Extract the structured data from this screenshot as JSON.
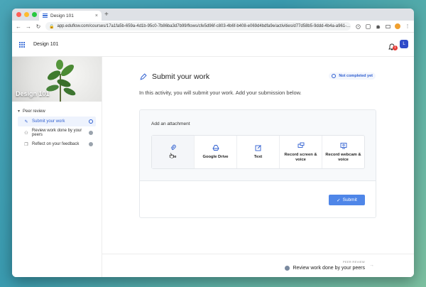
{
  "browser": {
    "tab_title": "Design 101",
    "tab_close": "×",
    "new_tab": "+",
    "url": "app.eduflow.com/courses/17a1fa5b-659a-4d1b-95c0-7b86ba3d7b99/flows/cfe5d96f-c803-4b6f-b408-e069d4bdfa9e/activities/d77d58b5-9ddd-4b4a-a961-...",
    "back": "←",
    "forward": "→",
    "reload": "↻",
    "lock": "🔒",
    "star": "☆",
    "menu": "⋮"
  },
  "header": {
    "course_title": "Design 101",
    "notification_count": "1",
    "user_initial": "L"
  },
  "sidebar": {
    "hero_title": "Design 101",
    "section_label": "Peer review",
    "section_chevron": "▾",
    "items": [
      {
        "label": "Submit your work",
        "icon": "✎"
      },
      {
        "label": "Review work done by your peers",
        "icon": "⚇"
      },
      {
        "label": "Reflect on your feedback",
        "icon": "❐"
      }
    ]
  },
  "content": {
    "title": "Submit your work",
    "status": "Not completed yet",
    "description": "In this activity, you will submit your work. Add your submission below.",
    "attach_label": "Add an attachment",
    "options": [
      {
        "label": "File"
      },
      {
        "label": "Google Drive"
      },
      {
        "label": "Text"
      },
      {
        "label": "Record screen & voice"
      },
      {
        "label": "Record webcam & voice"
      }
    ],
    "submit_label": "Submit",
    "submit_check": "✓"
  },
  "footer": {
    "next_small": "PEER REVIEW",
    "next_label": "Review work done by your peers",
    "next_arrow": "→"
  },
  "colors": {
    "accent": "#2f5fd0",
    "button": "#4f86e8",
    "badge": "#e53935"
  }
}
